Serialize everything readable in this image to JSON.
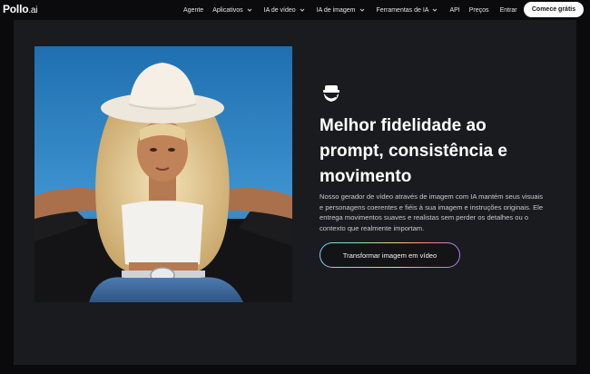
{
  "nav": {
    "logo_main": "Pollo",
    "logo_suffix": ".ai",
    "items": [
      {
        "label": "Agente",
        "dropdown": false
      },
      {
        "label": "Aplicativos",
        "dropdown": true
      },
      {
        "label": "IA de vídeo",
        "dropdown": true
      },
      {
        "label": "IA de imagem",
        "dropdown": true
      },
      {
        "label": "Ferramentas de IA",
        "dropdown": true
      },
      {
        "label": "API",
        "dropdown": false
      },
      {
        "label": "Preços",
        "dropdown": false
      },
      {
        "label": "Entrar",
        "dropdown": false
      }
    ],
    "cta": "Comece grátis"
  },
  "hero": {
    "image_icon": "cowgirl-photo",
    "feature_icon": "face-icon",
    "headline": "Melhor fidelidade ao prompt, consistência e movimento",
    "description": "Nosso gerador de vídeo através de imagem com IA mantém seus visuais e personagens coerentes e fiéis à sua imagem e instruções originais. Ele entrega movimentos suaves e realistas sem perder os detalhes ou o contexto que realmente importam.",
    "button_label": "Transformar imagem em vídeo"
  },
  "colors": {
    "background": "#0a0a0c",
    "panel": "#1a1b1f",
    "accent_gradient": [
      "#6fd6ff",
      "#7cf0a6",
      "#f6d56a",
      "#ff7a8a",
      "#b07cff"
    ]
  }
}
